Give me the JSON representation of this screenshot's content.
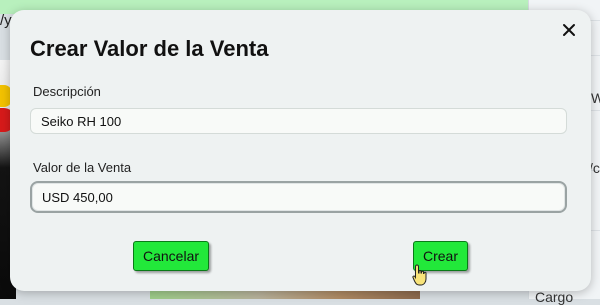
{
  "background": {
    "top_text": "/y",
    "right_texts": [
      "W",
      "/c",
      "Cargo"
    ]
  },
  "modal": {
    "title": "Crear Valor de la Venta",
    "description_label": "Descripción",
    "description_value": "Seiko RH 100",
    "valor_label": "Valor de la Venta",
    "valor_value": "USD 450,00",
    "cancel_label": "Cancelar",
    "create_label": "Crear"
  },
  "colors": {
    "button_green": "#22e83a",
    "modal_bg": "#eef2f2"
  },
  "icons": {
    "close": "close-icon",
    "cursor": "hand-pointer-icon"
  }
}
